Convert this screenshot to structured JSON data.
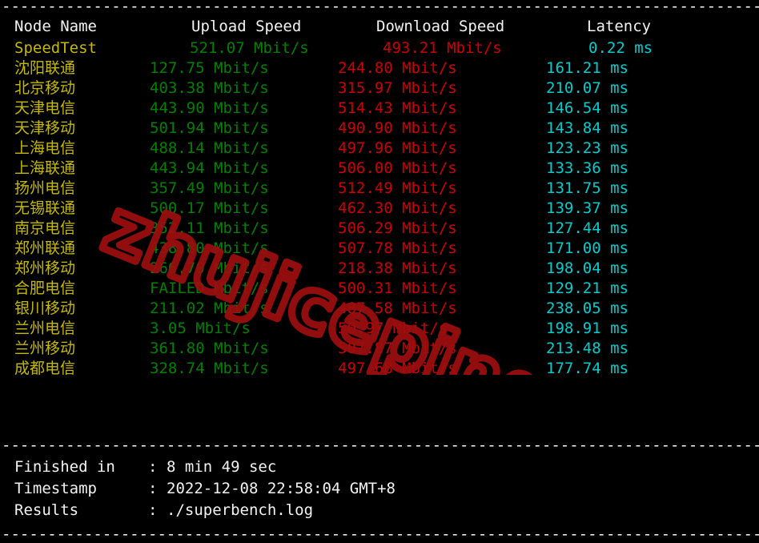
{
  "terminal": {
    "divider": "-------------------------------------------------------------------------------------------",
    "watermark": "zhujiceping.com"
  },
  "colors": {
    "background": "#000000",
    "header_text": "#f2f2f2",
    "node_name": "#c4b800",
    "upload": "#018000",
    "download": "#cd0000",
    "latency": "#00cdcd",
    "watermark": "#9e0f10"
  },
  "table": {
    "headers": {
      "node": "Node Name",
      "upload": "Upload Speed",
      "download": "Download Speed",
      "latency": "Latency"
    },
    "summary": {
      "node": "SpeedTest",
      "upload": "521.07 Mbit/s",
      "download": "493.21 Mbit/s",
      "latency": "0.22 ms"
    },
    "rows": [
      {
        "node": "沈阳联通",
        "upload": "127.75 Mbit/s",
        "download": "244.80 Mbit/s",
        "latency": "161.21 ms"
      },
      {
        "node": "北京移动",
        "upload": "403.38 Mbit/s",
        "download": "315.97 Mbit/s",
        "latency": "210.07 ms"
      },
      {
        "node": "天津电信",
        "upload": "443.90 Mbit/s",
        "download": "514.43 Mbit/s",
        "latency": "146.54 ms"
      },
      {
        "node": "天津移动",
        "upload": "501.94 Mbit/s",
        "download": "490.90 Mbit/s",
        "latency": "143.84 ms"
      },
      {
        "node": "上海电信",
        "upload": "488.14 Mbit/s",
        "download": "497.96 Mbit/s",
        "latency": "123.23 ms"
      },
      {
        "node": "上海联通",
        "upload": "443.94 Mbit/s",
        "download": "506.00 Mbit/s",
        "latency": "133.36 ms"
      },
      {
        "node": "扬州电信",
        "upload": "357.49 Mbit/s",
        "download": "512.49 Mbit/s",
        "latency": "131.75 ms"
      },
      {
        "node": "无锡联通",
        "upload": "500.17 Mbit/s",
        "download": "462.30 Mbit/s",
        "latency": "139.37 ms"
      },
      {
        "node": "南京电信",
        "upload": "352.11 Mbit/s",
        "download": "506.29 Mbit/s",
        "latency": "127.44 ms"
      },
      {
        "node": "郑州联通",
        "upload": "438.80 Mbit/s",
        "download": "507.78 Mbit/s",
        "latency": "171.00 ms"
      },
      {
        "node": "郑州移动",
        "upload": "266.70 Mbit/s",
        "download": "218.38 Mbit/s",
        "latency": "198.04 ms"
      },
      {
        "node": "合肥电信",
        "upload": "FAILED Mbit/s",
        "download": "500.31 Mbit/s",
        "latency": "129.21 ms"
      },
      {
        "node": "银川移动",
        "upload": "211.02 Mbit/s",
        "download": "487.58 Mbit/s",
        "latency": "238.05 ms"
      },
      {
        "node": "兰州电信",
        "upload": "3.05 Mbit/s",
        "download": "50.97 Mbit/s",
        "latency": "198.91 ms"
      },
      {
        "node": "兰州移动",
        "upload": "361.80 Mbit/s",
        "download": "507.87 Mbit/s",
        "latency": "213.48 ms"
      },
      {
        "node": "成都电信",
        "upload": "328.74 Mbit/s",
        "download": "497.68 Mbit/s",
        "latency": "177.74 ms"
      }
    ]
  },
  "footer": {
    "colon": ":",
    "items": [
      {
        "label": "Finished in",
        "value": "8 min 49 sec"
      },
      {
        "label": "Timestamp",
        "value": "2022-12-08 22:58:04 GMT+8"
      },
      {
        "label": "Results",
        "value": "./superbench.log"
      }
    ]
  }
}
